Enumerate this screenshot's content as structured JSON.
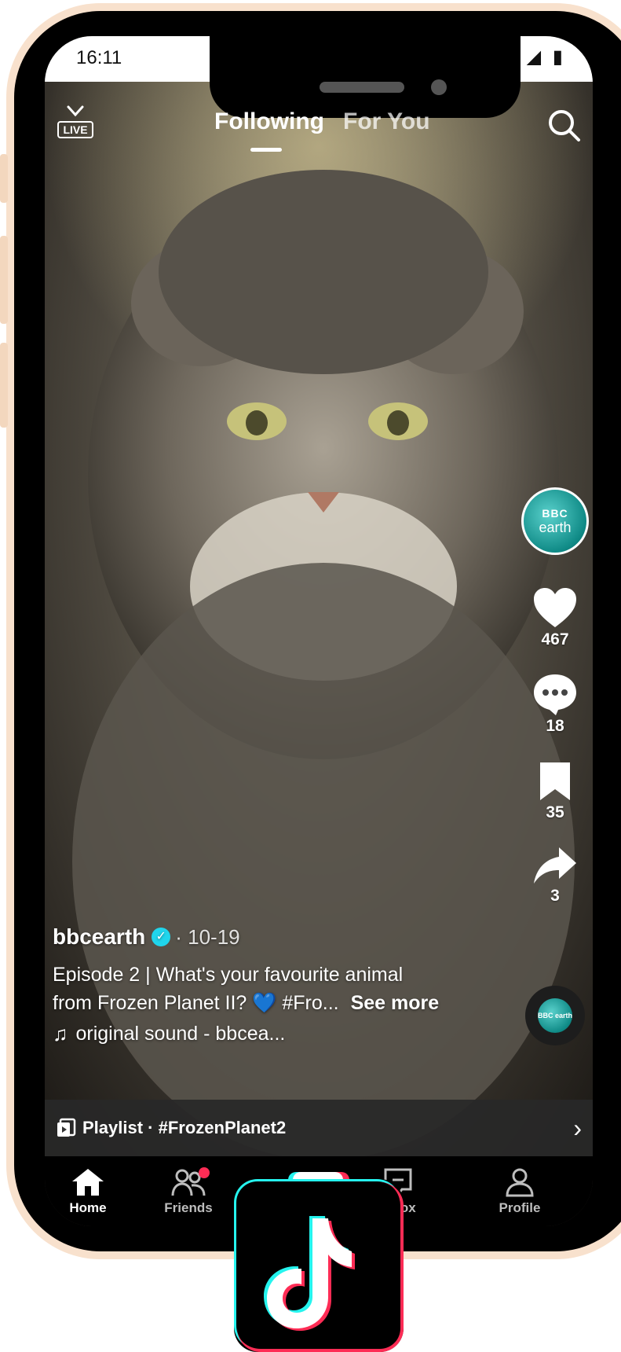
{
  "status_bar": {
    "time": "16:11",
    "icons": "⊖ ▼◢ ▮"
  },
  "top_bar": {
    "live_label": "LIVE",
    "tabs": [
      {
        "label": "Following",
        "active": true
      },
      {
        "label": "For You",
        "active": false
      }
    ]
  },
  "video": {
    "subject_icon": "pallas-cat"
  },
  "creator": {
    "avatar_line1": "BBC",
    "avatar_line2": "earth"
  },
  "actions": {
    "likes": "467",
    "comments": "18",
    "saves": "35",
    "shares": "3"
  },
  "music_disc": {
    "label": "BBC earth"
  },
  "caption": {
    "username": "bbcearth",
    "date": "· 10-19",
    "line1": "Episode 2 | What's your favourite animal",
    "line2_text": "from Frozen Planet II?",
    "line2_emoji": "💙",
    "line2_tag": "#Fro...",
    "see_more": "See more",
    "sound": "original sound - bbcea..."
  },
  "playlist": {
    "label": "Playlist · #FrozenPlanet2"
  },
  "bottom_nav": {
    "home": "Home",
    "friends": "Friends",
    "create": "+",
    "inbox": "Inbox",
    "profile": "Profile"
  },
  "colors": {
    "accent_cyan": "#25f4ee",
    "accent_red": "#fe2c55",
    "bezel": "#000000",
    "case": "#f8e1cd"
  }
}
